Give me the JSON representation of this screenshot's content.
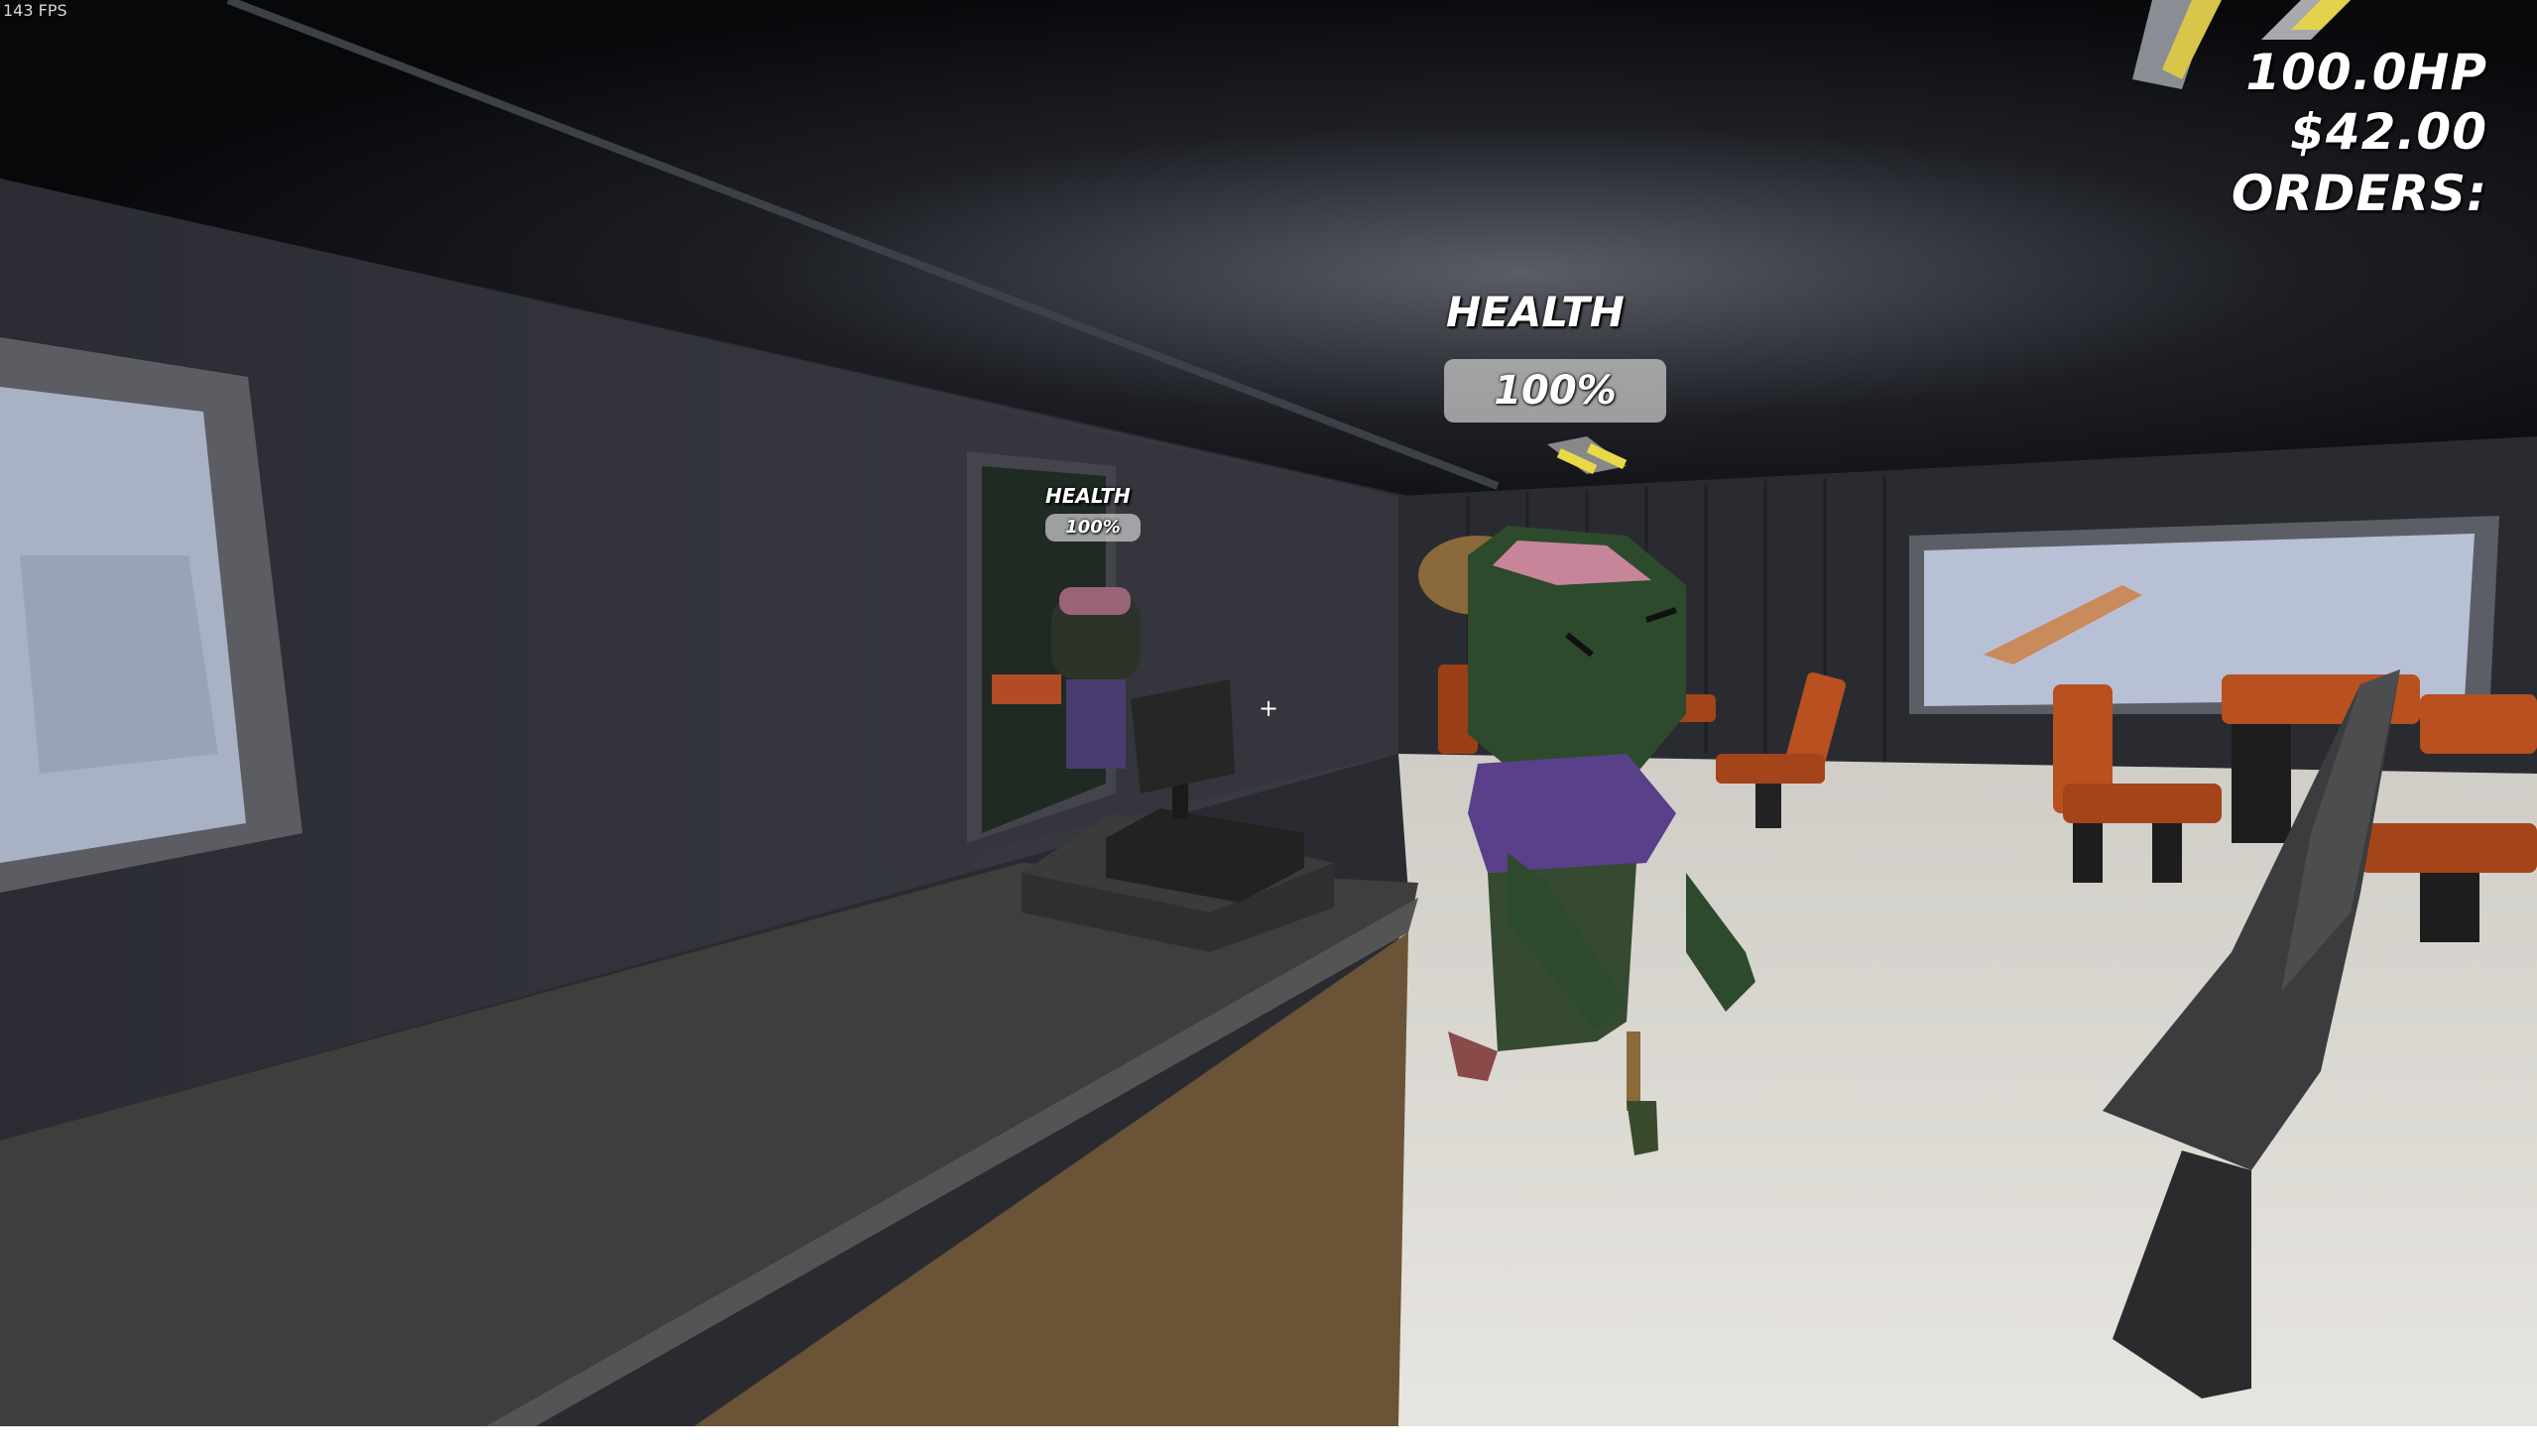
{
  "fps_counter": "143 FPS",
  "hud": {
    "hp": "100.0HP",
    "money": "$42.00",
    "orders": "ORDERS:"
  },
  "crosshair": "+",
  "npc_health": [
    {
      "label": "HEALTH",
      "value": "100%"
    },
    {
      "label": "HEALTH",
      "value": "100%"
    }
  ],
  "colors": {
    "ceiling": "#0d0e12",
    "wall": "#2f3038",
    "floor": "#d9d8d2",
    "counter_top": "#454444",
    "counter_front": "#6a5336",
    "chair_seat": "#c85a2a",
    "npc_skin": "#2e4a2c",
    "npc_shirt": "#5a3f8a",
    "npc_brain": "#c7859a",
    "knife_blade": "#3b3c3d",
    "window_glass": "#b8c0d6"
  },
  "icons": {
    "held_item": "kitchen-knife-icon",
    "hud_weapon": "knife-silhouette-icon"
  }
}
